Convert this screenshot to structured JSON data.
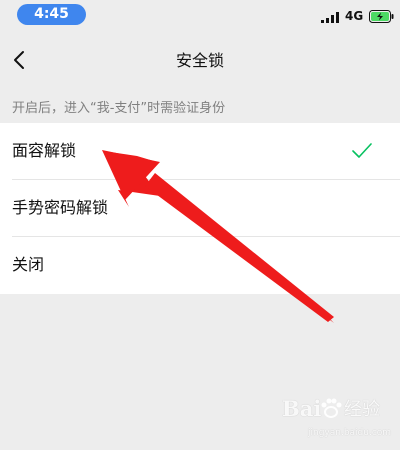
{
  "status_bar": {
    "time": "4:45",
    "network": "4G",
    "time_pill_color": "#3f86ee",
    "battery_color": "#4cd964"
  },
  "nav": {
    "title": "安全锁",
    "back_icon": "chevron-left-icon"
  },
  "hint": "开启后，进入“我-支付”时需验证身份",
  "options": [
    {
      "label": "面容解锁",
      "selected": true
    },
    {
      "label": "手势密码解锁",
      "selected": false
    },
    {
      "label": "关闭",
      "selected": false
    }
  ],
  "check_color": "#07c160",
  "annotation_color": "#ee1c1c",
  "watermark": {
    "brand": "Bai",
    "sub": "经验",
    "url": "jingyan.baidu.com",
    "icon": "paw-icon"
  }
}
